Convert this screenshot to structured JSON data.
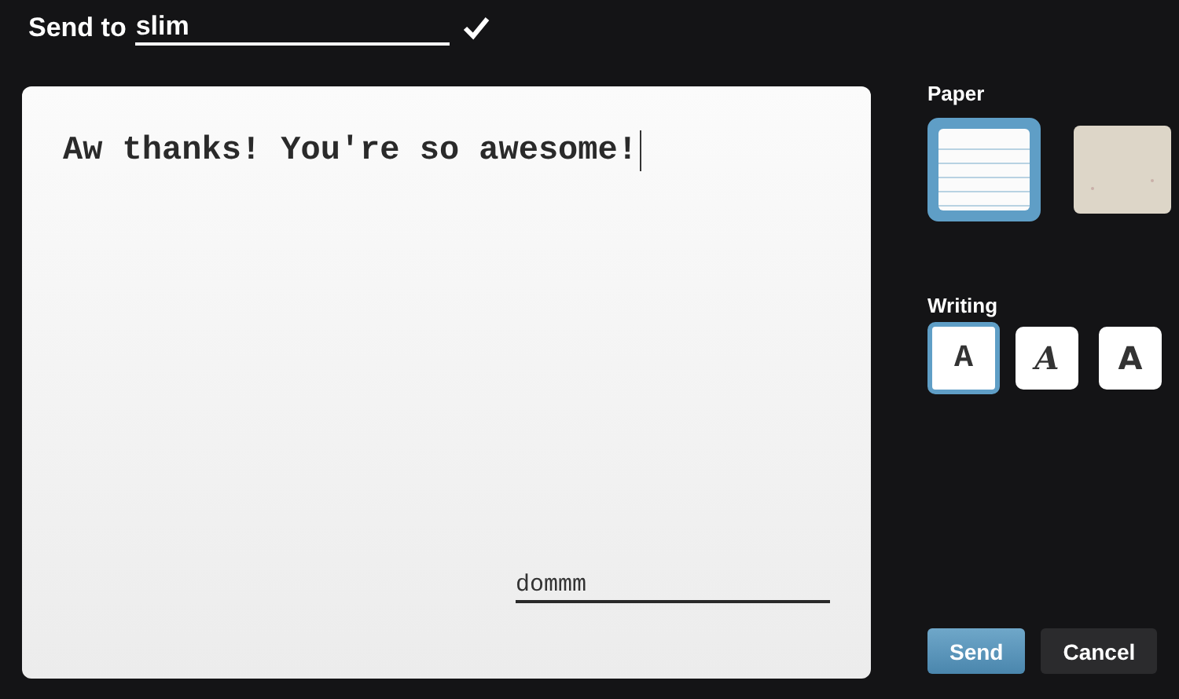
{
  "header": {
    "label": "Send to",
    "recipient": "slim"
  },
  "note": {
    "message": "Aw thanks! You're so awesome!",
    "signature": "dommm"
  },
  "paper": {
    "label": "Paper",
    "options": [
      {
        "kind": "lined",
        "selected": true
      },
      {
        "kind": "parchment",
        "selected": false
      }
    ]
  },
  "writing": {
    "label": "Writing",
    "options": [
      {
        "glyph": "A",
        "kind": "typewriter",
        "selected": true
      },
      {
        "glyph": "A",
        "kind": "hand",
        "selected": false
      },
      {
        "glyph": "A",
        "kind": "sans",
        "selected": false
      }
    ]
  },
  "buttons": [
    {
      "label": "Send",
      "kind": "primary"
    },
    {
      "label": "Cancel",
      "kind": "secondary"
    }
  ]
}
